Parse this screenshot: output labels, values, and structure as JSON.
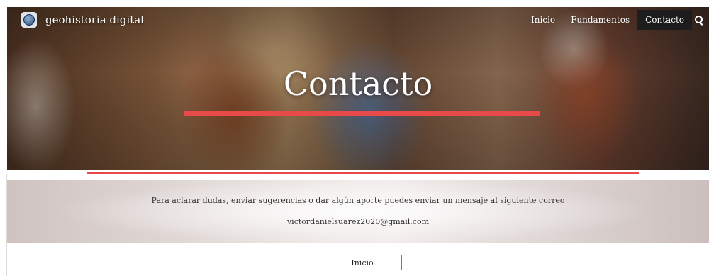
{
  "header": {
    "site_title": "geohistoria digital",
    "nav": [
      {
        "label": "Inicio",
        "active": false
      },
      {
        "label": "Fundamentos",
        "active": false
      },
      {
        "label": "Contacto",
        "active": true
      }
    ],
    "search_icon": "search-icon",
    "logo_icon": "globe-logo-icon"
  },
  "hero": {
    "title": "Contacto",
    "accent_color": "#e84a4a"
  },
  "content": {
    "message": "Para aclarar dudas, enviar sugerencias o dar algún aporte puedes enviar un mensaje al siguiente correo",
    "email": "victordanielsuarez2020@gmail.com"
  },
  "footer": {
    "button_label": "Inicio"
  }
}
